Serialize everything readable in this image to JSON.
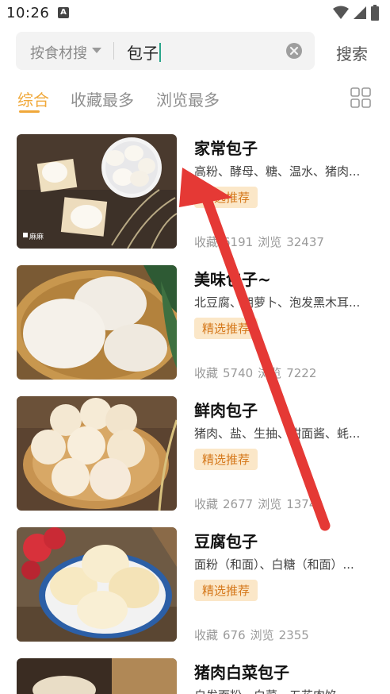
{
  "status_bar": {
    "time": "10:26",
    "notification_letter": "A"
  },
  "search": {
    "category_label": "按食材搜",
    "query": "包子",
    "submit_label": "搜索"
  },
  "tabs": [
    {
      "label": "综合",
      "active": true
    },
    {
      "label": "收藏最多",
      "active": false
    },
    {
      "label": "浏览最多",
      "active": false
    }
  ],
  "results": [
    {
      "title": "家常包子",
      "ingredients": "高粉、酵母、糖、温水、猪肉...",
      "badge": "精选推荐",
      "fav_label": "收藏",
      "favorites": "6191",
      "view_label": "浏览",
      "views": "32437",
      "watermark": "麻麻"
    },
    {
      "title": "美味包子~",
      "ingredients": "北豆腐、胡萝卜、泡发黑木耳...",
      "badge": "精选推荐",
      "fav_label": "收藏",
      "favorites": "5740",
      "view_label": "浏览",
      "views": "7222"
    },
    {
      "title": "鲜肉包子",
      "ingredients": "猪肉、盐、生抽、甜面酱、蚝...",
      "badge": "精选推荐",
      "fav_label": "收藏",
      "favorites": "2677",
      "view_label": "浏览",
      "views": "1374"
    },
    {
      "title": "豆腐包子",
      "ingredients": "面粉（和面）、白糖（和面）...",
      "badge": "精选推荐",
      "fav_label": "收藏",
      "favorites": "676",
      "view_label": "浏览",
      "views": "2355"
    },
    {
      "title": "猪肉白菜包子",
      "ingredients": "自发面粉、白菜、五花肉馅..."
    }
  ],
  "colors": {
    "accent": "#f0a83a",
    "badge_text": "#d5781b",
    "badge_bg": "#fbe7c8",
    "annotation_arrow": "#e53935"
  },
  "icons": {
    "wifi": "wifi-icon",
    "signal": "signal-icon",
    "battery": "battery-icon",
    "dropdown": "chevron-down-icon",
    "clear": "clear-icon",
    "layout": "grid-view-icon"
  }
}
